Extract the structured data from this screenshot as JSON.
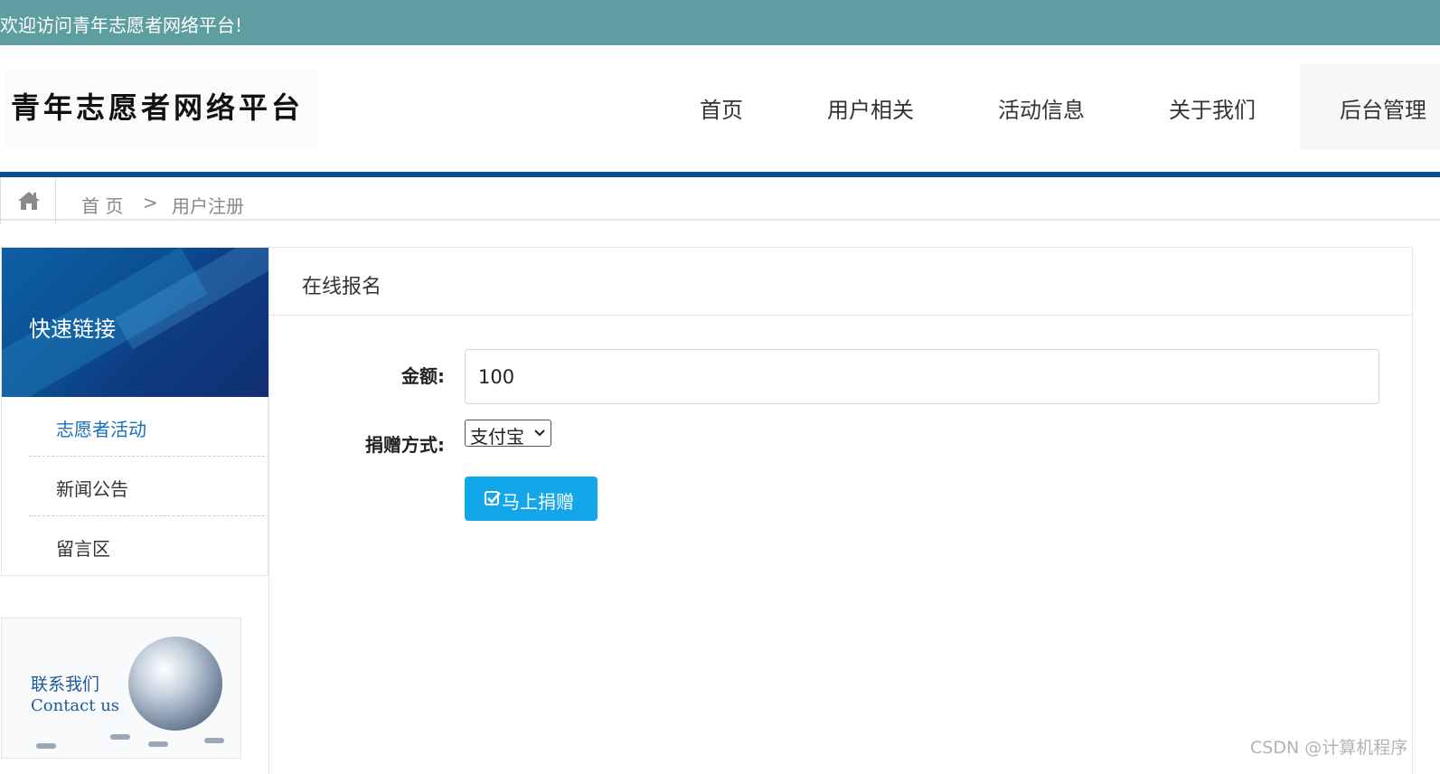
{
  "topbar": {
    "welcome": "欢迎访问青年志愿者网络平台!"
  },
  "logo": {
    "text": "青年志愿者网络平台"
  },
  "nav": {
    "items": [
      "首页",
      "用户相关",
      "活动信息",
      "关于我们",
      "后台管理"
    ]
  },
  "breadcrumb": {
    "home": "首 页",
    "separator": ">",
    "current": "用户注册"
  },
  "sidebar": {
    "title": "快速链接",
    "items": [
      {
        "label": "志愿者活动",
        "active": true
      },
      {
        "label": "新闻公告",
        "active": false
      },
      {
        "label": "留言区",
        "active": false
      }
    ]
  },
  "contact": {
    "cn": "联系我们",
    "en": "Contact us"
  },
  "main": {
    "title": "在线报名",
    "amount_label": "金额:",
    "amount_value": "100",
    "method_label": "捐赠方式:",
    "method_value": "支付宝",
    "submit_label": "马上捐赠"
  },
  "watermark": "CSDN @计算机程序",
  "colors": {
    "topbar": "#5f9ea0",
    "navline": "#0b4f8a",
    "button": "#11a7e8",
    "link": "#1a6fb5"
  }
}
